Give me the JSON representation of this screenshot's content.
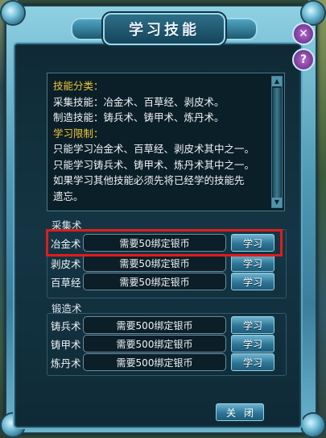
{
  "window": {
    "title": "学习技能"
  },
  "description": {
    "lines": [
      {
        "text": "技能分类：",
        "color": "yellow"
      },
      {
        "text": "采集技能：冶金术、百草经、剥皮术。",
        "color": "white"
      },
      {
        "text": "制造技能：铸兵术、铸甲术、炼丹术。",
        "color": "white"
      },
      {
        "text": "学习限制：",
        "color": "yellow"
      },
      {
        "text": "只能学习冶金术、百草经、剥皮术其中之一。",
        "color": "white"
      },
      {
        "text": "只能学习铸兵术、铸甲术、炼丹术其中之一。",
        "color": "white"
      },
      {
        "text": "如果学习其他技能必须先将已经学的技能先",
        "color": "white"
      },
      {
        "text": "遗忘。",
        "color": "white"
      }
    ]
  },
  "sections": {
    "gather": {
      "label": "采集术",
      "skills": [
        {
          "name": "冶金术",
          "cost": "需要50绑定银币",
          "button": "学习"
        },
        {
          "name": "剥皮术",
          "cost": "需要50绑定银币",
          "button": "学习"
        },
        {
          "name": "百草经",
          "cost": "需要50绑定银币",
          "button": "学习"
        }
      ]
    },
    "forge": {
      "label": "锻造术",
      "skills": [
        {
          "name": "铸兵术",
          "cost": "需要500绑定银币",
          "button": "学习"
        },
        {
          "name": "铸甲术",
          "cost": "需要500绑定银币",
          "button": "学习"
        },
        {
          "name": "炼丹术",
          "cost": "需要500绑定银币",
          "button": "学习"
        }
      ]
    }
  },
  "footer": {
    "close_label": "关闭"
  },
  "icons": {
    "close": "close-icon",
    "help": "help-icon"
  },
  "colors": {
    "highlight": "#e21b1b",
    "heading_yellow": "#f0c534"
  }
}
